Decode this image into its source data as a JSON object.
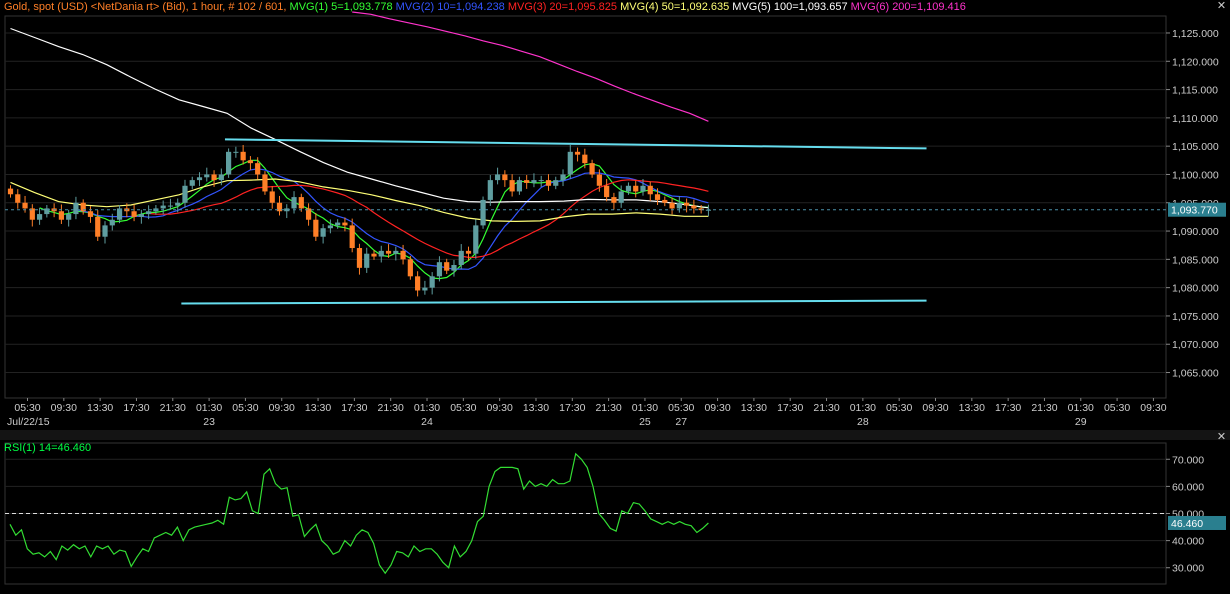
{
  "header": {
    "instrument": "Gold, spot (USD) <NetDania rt> (Bid), 1 hour, # 102 / 601,",
    "ma_labels": [
      {
        "text": "MVG(1) 5=1,093.778",
        "color": "#33ff33"
      },
      {
        "text": "MVG(2) 10=1,094.238",
        "color": "#3355ff"
      },
      {
        "text": "MVG(3) 20=1,095.825",
        "color": "#ff2222"
      },
      {
        "text": "MVG(4) 50=1,092.635",
        "color": "#ffff77"
      },
      {
        "text": "MVG(5) 100=1,093.657",
        "color": "#ffffff"
      },
      {
        "text": "MVG(6) 200=1,109.416",
        "color": "#ff33cc"
      }
    ]
  },
  "rsi_header": "RSI(1) 14=46.460",
  "colors": {
    "up_candle": "#5f9ea0",
    "down_candle": "#ff7f27",
    "support_resistance": "#66ddee",
    "grid": "#222222",
    "rsi_line": "#33dd33"
  },
  "chart_data": [
    {
      "type": "candlestick",
      "y_ticks": [
        "1,065.000",
        "1,070.000",
        "1,075.000",
        "1,080.000",
        "1,085.000",
        "1,090.000",
        "1,095.000",
        "1,100.000",
        "1,105.000",
        "1,110.000",
        "1,115.000",
        "1,120.000",
        "1,125.000"
      ],
      "ylim": [
        1060.5,
        1128
      ],
      "x_time_ticks": [
        "05:30",
        "09:30",
        "13:30",
        "17:30",
        "21:30",
        "01:30",
        "05:30",
        "09:30",
        "13:30",
        "17:30",
        "21:30",
        "01:30",
        "05:30",
        "09:30",
        "13:30",
        "17:30",
        "21:30",
        "01:30",
        "05:30",
        "09:30",
        "13:30",
        "17:30",
        "21:30",
        "01:30",
        "05:30",
        "09:30",
        "13:30",
        "17:30",
        "21:30",
        "01:30",
        "05:30",
        "09:30"
      ],
      "x_date_ticks": [
        {
          "label": "Jul/22/15",
          "index": 0
        },
        {
          "label": "23",
          "index": 5
        },
        {
          "label": "24",
          "index": 11
        },
        {
          "label": "25",
          "index": 17
        },
        {
          "label": "27",
          "index": 18
        },
        {
          "label": "28",
          "index": 23
        },
        {
          "label": "29",
          "index": 29
        }
      ],
      "last_price": "1,093.770",
      "last_value": 1093.77,
      "close": [
        1096.5,
        1095,
        1094,
        1092,
        1093,
        1094,
        1093.5,
        1092,
        1093,
        1095,
        1093.5,
        1092.5,
        1089,
        1091,
        1092,
        1094,
        1093.5,
        1092.5,
        1093,
        1093.5,
        1094,
        1094.5,
        1094.5,
        1095,
        1098,
        1099,
        1099.5,
        1100,
        1099,
        1100,
        1104,
        1104,
        1102.5,
        1102,
        1100,
        1097,
        1095,
        1093.5,
        1094,
        1096,
        1094,
        1092,
        1089,
        1090.5,
        1091,
        1091.5,
        1091,
        1087,
        1083.5,
        1086,
        1085.5,
        1086.5,
        1086,
        1086.5,
        1085,
        1082,
        1079.5,
        1080,
        1082,
        1084.5,
        1083,
        1084,
        1086.5,
        1086,
        1091,
        1095.5,
        1099,
        1100,
        1099,
        1097,
        1099,
        1098.5,
        1099,
        1099,
        1098,
        1099,
        1100,
        1104,
        1103.5,
        1102,
        1100,
        1098,
        1096,
        1095,
        1097,
        1098,
        1097,
        1098,
        1096.5,
        1095.5,
        1095,
        1094,
        1095,
        1094.5,
        1094,
        1093.7,
        1093.77
      ],
      "ma": [
        {
          "name": "MVG(1) 5",
          "period": 5,
          "color": "#33ff33"
        },
        {
          "name": "MVG(2) 10",
          "period": 10,
          "color": "#3355ff"
        },
        {
          "name": "MVG(3) 20",
          "period": 20,
          "color": "#ff2222"
        },
        {
          "name": "MVG(4) 50",
          "values": [
            1098.6,
            1096.8,
            1095.2,
            1094.6,
            1094.3,
            1094.6,
            1095.5,
            1096.4,
            1097.8,
            1098.9,
            1099,
            1099.2,
            1098.7,
            1097.8,
            1097.2,
            1096.4,
            1095.4,
            1094.5,
            1093.3,
            1092.3,
            1091.8,
            1091.7,
            1091.8,
            1092.5,
            1093,
            1093,
            1093.2,
            1093,
            1092.6,
            1092.6
          ],
          "color": "#ffff77"
        },
        {
          "name": "MVG(5) 100",
          "values": [
            1125.8,
            1124.2,
            1122.6,
            1121.2,
            1119.4,
            1117.2,
            1115.1,
            1113.2,
            1112,
            1110.8,
            1108.2,
            1106.2,
            1104.1,
            1102.1,
            1100.4,
            1099.2,
            1098,
            1096.9,
            1095.8,
            1095.2,
            1095.1,
            1095.2,
            1095.2,
            1095.3,
            1095.6,
            1095.5,
            1095.5,
            1095.2,
            1094.7,
            1094.1
          ],
          "color": "#ffffff"
        },
        {
          "name": "MVG(6) 200",
          "values": [
            1128.7,
            1128.3,
            1127.5,
            1126.8,
            1126.1,
            1125.3,
            1124.5,
            1123.6,
            1122.8,
            1121.8,
            1120.8,
            1119.5,
            1118.2,
            1117,
            1115.6,
            1114.3,
            1113.1,
            1111.9,
            1110.8,
            1109.4
          ],
          "color": "#ff33cc"
        }
      ],
      "trendlines": [
        {
          "start_index": 29.5,
          "start_value": 1106.2,
          "end_index": 126,
          "end_value": 1104.6
        },
        {
          "start_index": 23.5,
          "start_value": 1077.2,
          "end_index": 126,
          "end_value": 1077.7
        }
      ]
    },
    {
      "type": "line",
      "y_ticks": [
        "30.000",
        "40.000",
        "50.000",
        "60.000",
        "70.000"
      ],
      "ylim": [
        24,
        76
      ],
      "overbought_level": 50,
      "last_value": "46.460",
      "series": [
        {
          "name": "RSI(1) 14",
          "values": [
            46,
            42,
            44,
            37,
            35,
            35.5,
            34,
            36,
            33,
            38,
            36.5,
            38.5,
            37,
            38,
            34,
            38,
            37,
            38,
            35,
            36.5,
            36,
            30.5,
            34,
            37,
            36,
            41,
            42,
            43,
            42,
            45,
            40,
            44,
            45,
            45.5,
            46,
            46.5,
            47.5,
            46,
            56,
            55,
            55.5,
            58,
            51,
            50,
            64.5,
            66.5,
            61,
            59,
            59.5,
            49,
            49.5,
            41.5,
            44,
            46,
            40,
            38,
            35,
            36,
            40,
            38,
            42,
            44,
            43,
            39,
            31,
            28,
            31,
            36,
            35.5,
            34,
            38,
            36,
            37,
            37,
            35,
            32,
            30,
            38,
            34,
            36,
            40,
            47,
            49,
            60,
            65.5,
            67,
            67,
            67,
            66.5,
            59,
            62,
            60,
            61,
            60,
            62.5,
            61,
            61,
            62,
            72,
            70,
            67,
            60,
            50,
            47.5,
            44.5,
            43.5,
            51,
            50,
            54,
            53.5,
            51,
            48,
            47,
            46,
            47,
            46,
            47,
            46,
            45.5,
            43,
            44.5,
            46.5
          ]
        }
      ]
    }
  ]
}
